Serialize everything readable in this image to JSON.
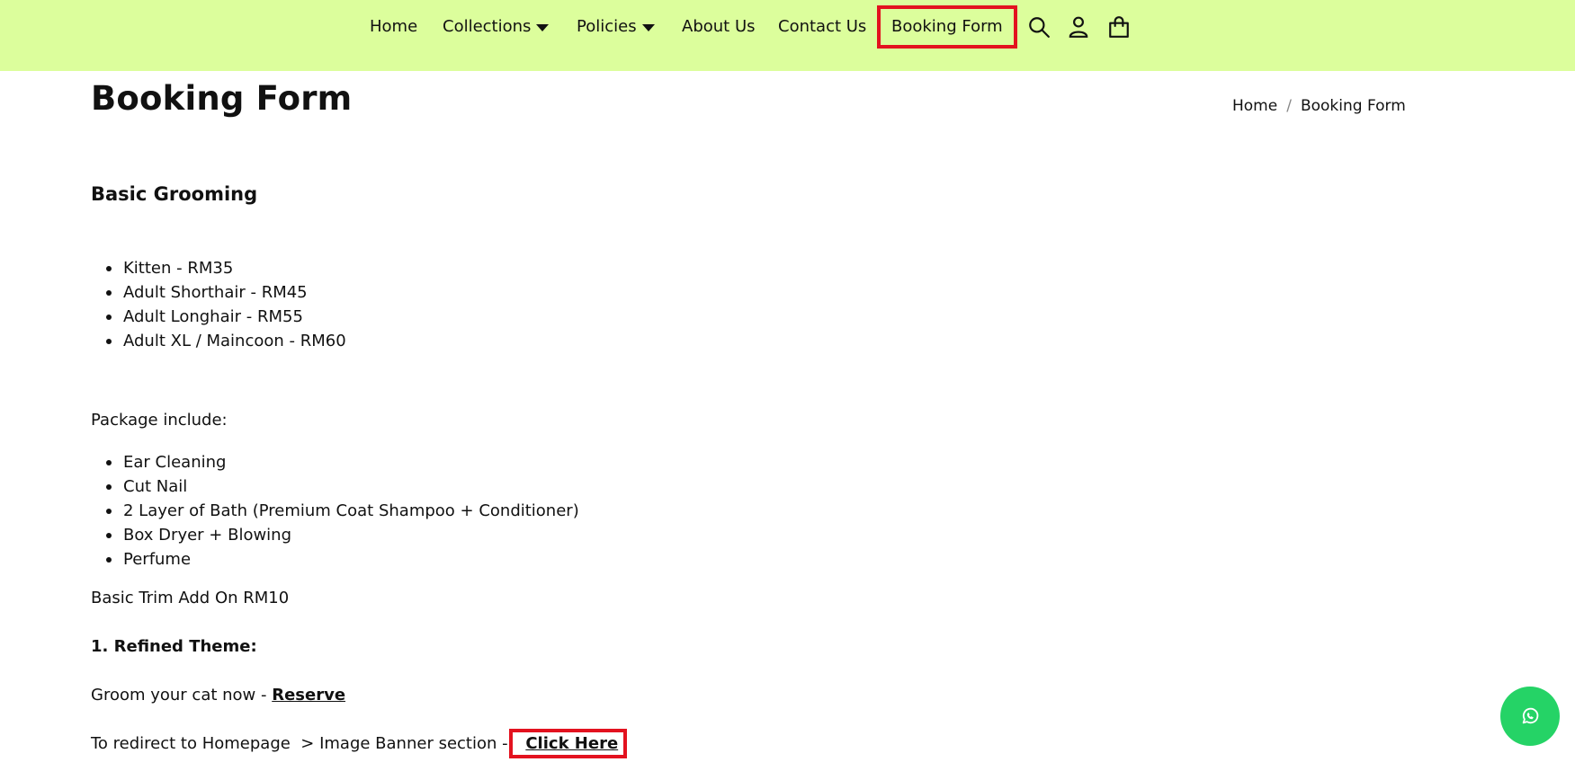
{
  "nav": {
    "items": [
      {
        "label": "Home",
        "has_dropdown": false
      },
      {
        "label": "Collections",
        "has_dropdown": true
      },
      {
        "label": "Policies",
        "has_dropdown": true
      },
      {
        "label": "About Us",
        "has_dropdown": false
      },
      {
        "label": "Contact Us",
        "has_dropdown": false
      },
      {
        "label": "Booking Form",
        "has_dropdown": false,
        "active": true
      }
    ],
    "icons": [
      "search-icon",
      "account-icon",
      "cart-icon"
    ],
    "background": "#dcfe9c",
    "highlight_color": "#e3121f"
  },
  "page": {
    "title": "Booking Form",
    "breadcrumb": [
      "Home",
      "Booking Form"
    ]
  },
  "content": {
    "section_heading": "Basic Grooming",
    "prices": [
      "Kitten - RM35",
      "Adult Shorthair - RM45",
      "Adult Longhair - RM55",
      "Adult XL / Maincoon - RM60"
    ],
    "package_label": "Package include:",
    "package_items": [
      "Ear Cleaning",
      "Cut Nail",
      "2 Layer of Bath (Premium Coat Shampoo + Conditioner)",
      "Box Dryer + Blowing",
      "Perfume"
    ],
    "addon": "Basic Trim Add On RM10",
    "theme_heading": "1. Refined Theme:",
    "groom_text": "Groom your cat now - ",
    "reserve_link": "Reserve",
    "redirect_text": "To redirect to Homepage  > Image Banner section - ",
    "click_here_link": "Click Here"
  },
  "floating": {
    "whatsapp_icon": "whatsapp-icon",
    "whatsapp_color": "#25d366"
  }
}
